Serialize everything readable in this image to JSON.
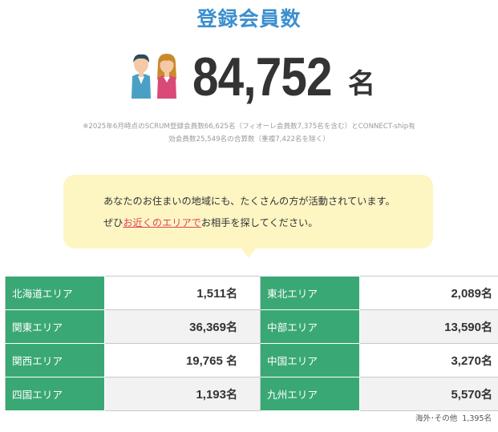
{
  "header": {
    "title": "登録会員数"
  },
  "member_count": {
    "number": "84,752",
    "unit": "名",
    "icons": [
      "male-member-icon",
      "female-member-icon"
    ]
  },
  "note": {
    "line1": "※2025年6月時点のSCRUM登録会員数66,625名（フィオーレ会員数7,375名を含む）とCONNECT-ship有",
    "line2": "効会員数25,549名の合算数（重複7,422名を除く）"
  },
  "bubble": {
    "line1": "あなたのお住まいの地域にも、たくさんの方が活動されています。",
    "line2_prefix": "ぜひ",
    "line2_link": "お近くのエリアで",
    "line2_suffix": "お相手を探してください。"
  },
  "regions": {
    "unit": "名",
    "rows": [
      {
        "left_name": "北海道エリア",
        "left_value": "1,511",
        "right_name": "東北エリア",
        "right_value": "2,089"
      },
      {
        "left_name": "関東エリア",
        "left_value": "36,369",
        "right_name": "中部エリア",
        "right_value": "13,590"
      },
      {
        "left_name": "関西エリア",
        "left_value": "19,765 ",
        "right_name": "中国エリア",
        "right_value": "3,270"
      },
      {
        "left_name": "四国エリア",
        "left_value": "1,193",
        "right_name": "九州エリア",
        "right_value": "5,570"
      }
    ]
  },
  "footnote": {
    "label": "海外･その他",
    "value": "1,395名"
  },
  "colors": {
    "title": "#3b8fcf",
    "region_header": "#3aa875",
    "bubble_bg": "#fdf6c3",
    "link": "#e0425b"
  }
}
